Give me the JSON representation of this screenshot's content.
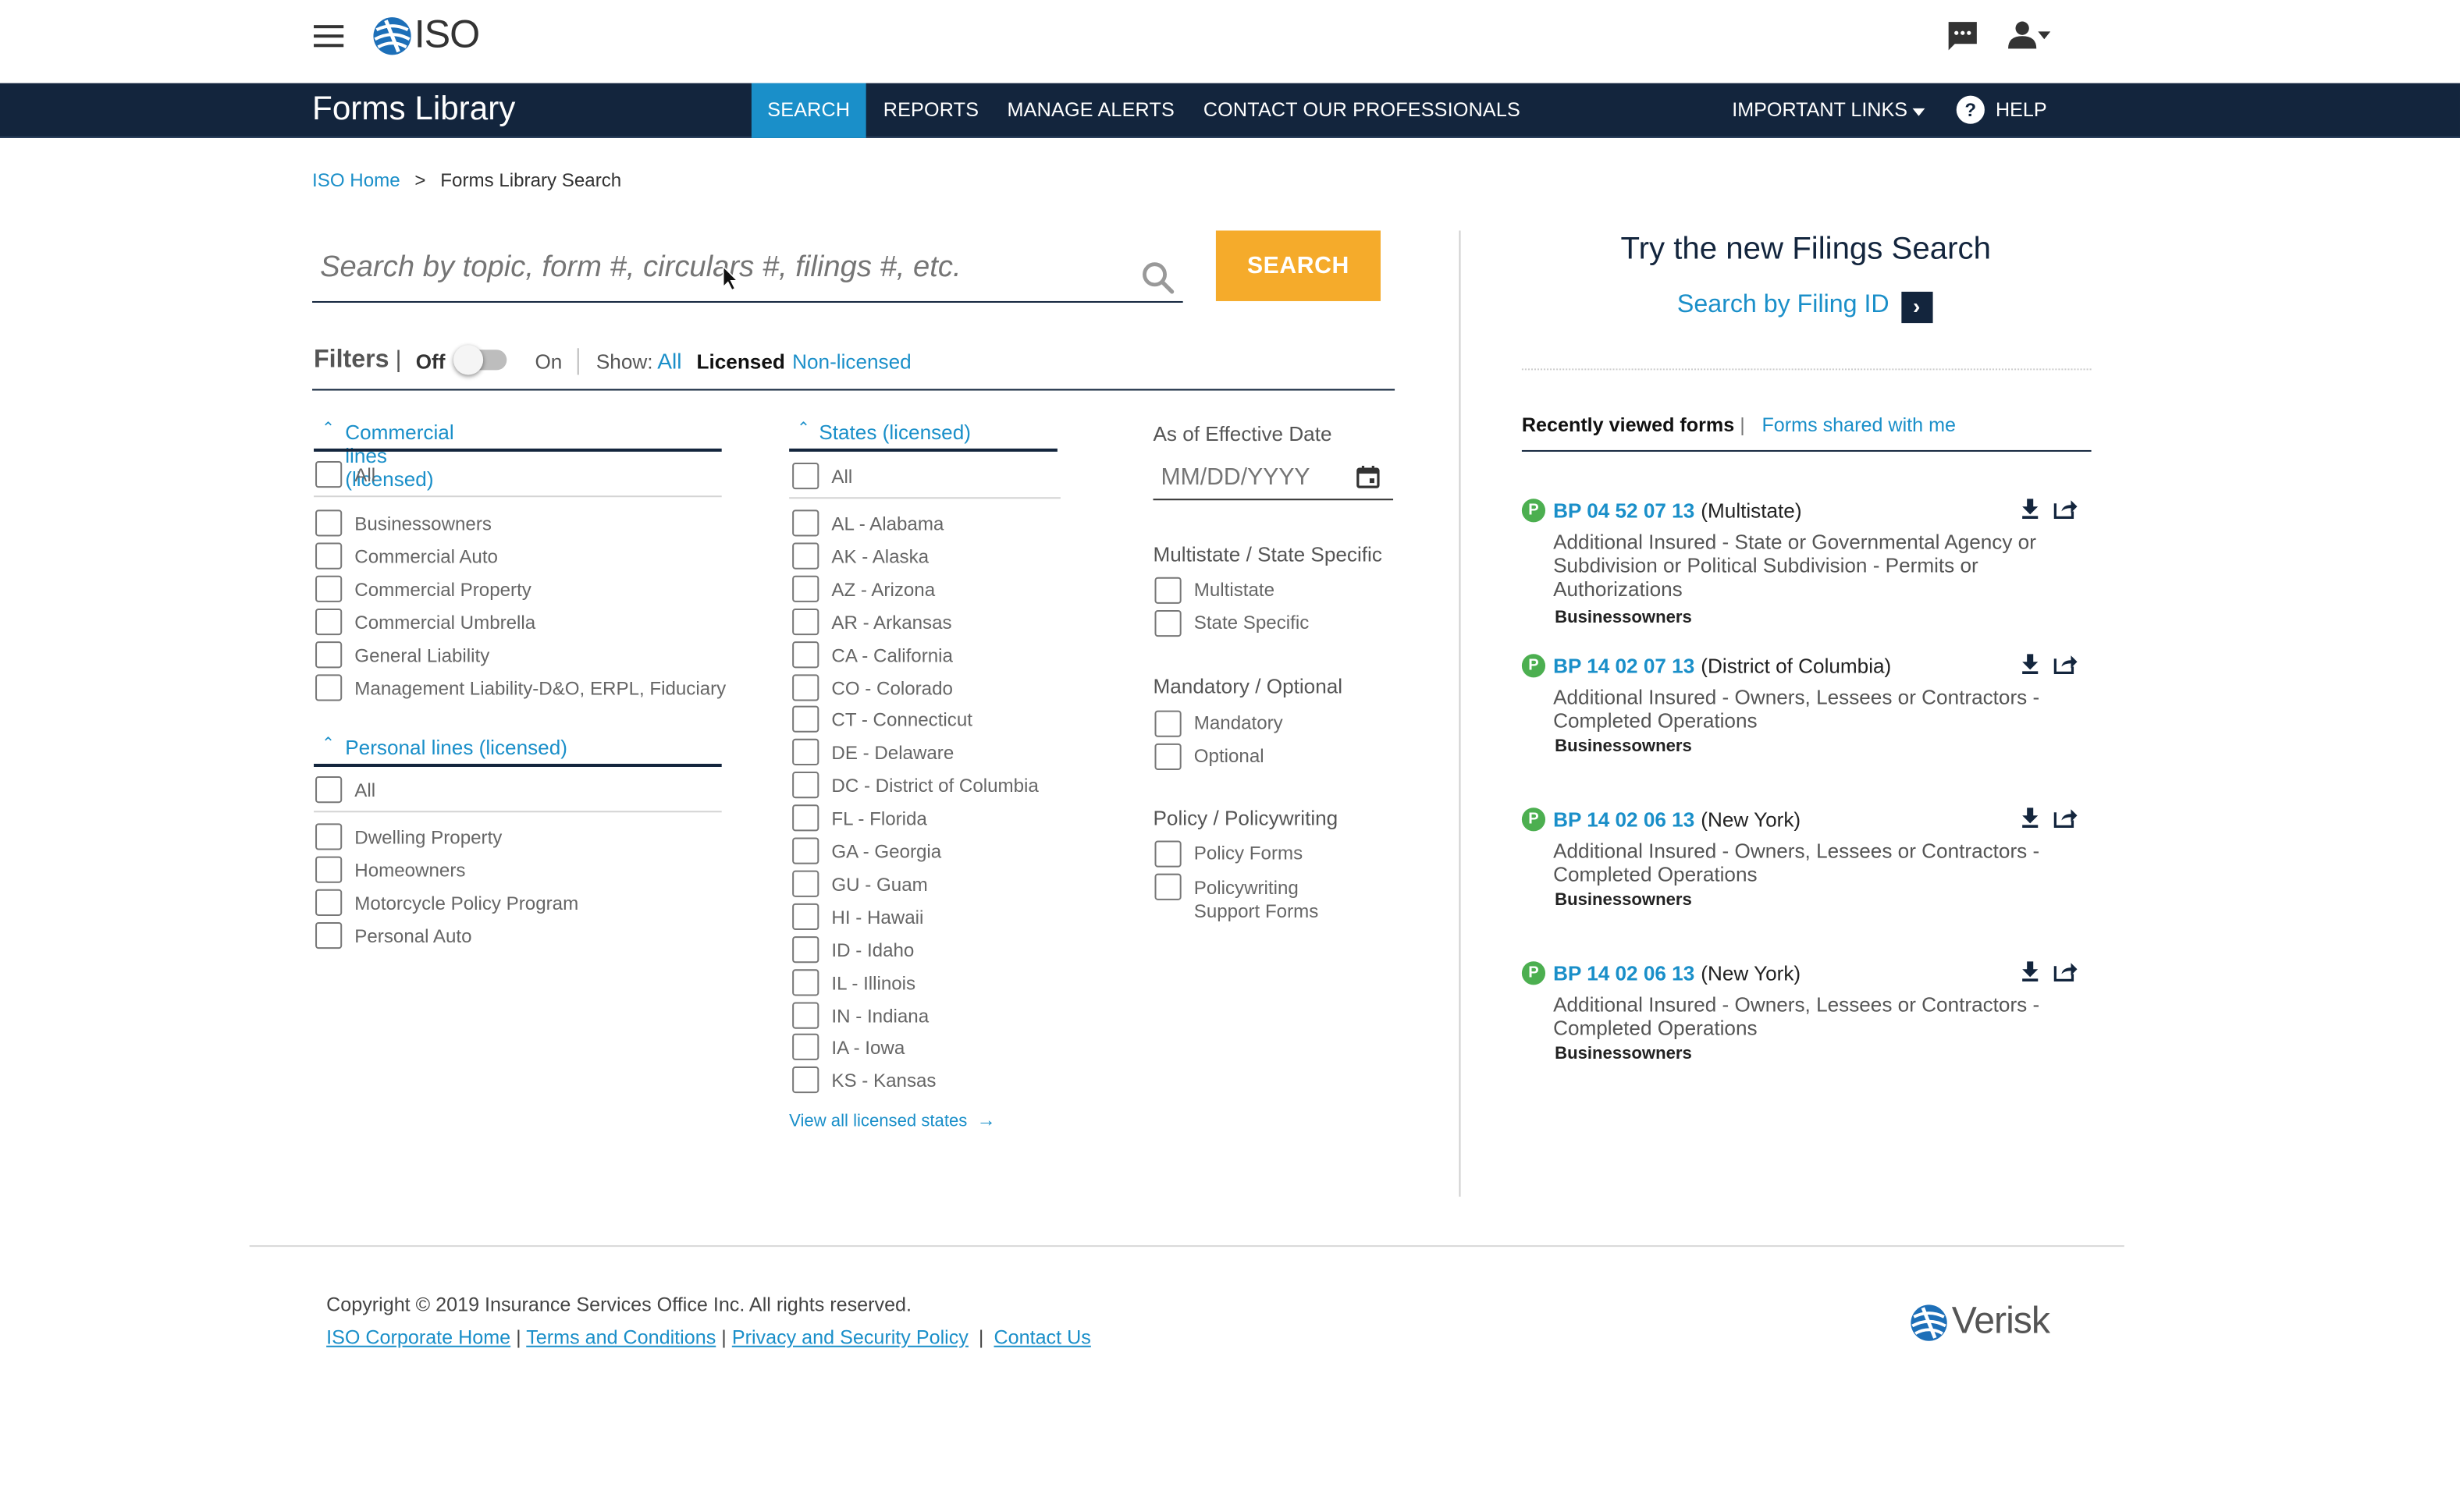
{
  "header": {
    "logo_text": "ISO",
    "icons": {
      "menu": "hamburger-menu-icon",
      "chat": "chat-icon",
      "user": "user-account-icon"
    }
  },
  "nav": {
    "app_title": "Forms Library",
    "items": [
      {
        "label": "SEARCH",
        "active": true
      },
      {
        "label": "REPORTS"
      },
      {
        "label": "MANAGE ALERTS"
      },
      {
        "label": "CONTACT OUR PROFESSIONALS"
      }
    ],
    "important_links": "IMPORTANT LINKS",
    "help": "HELP"
  },
  "breadcrumb": {
    "home": "ISO Home",
    "sep": ">",
    "current": "Forms Library Search"
  },
  "search": {
    "placeholder": "Search by topic, form #, circulars #, filings #, etc.",
    "button": "SEARCH"
  },
  "filters": {
    "title": "Filters",
    "sep": "|",
    "off": "Off",
    "on": "On",
    "show_label": "Show:",
    "show_all": "All",
    "show_licensed": "Licensed",
    "show_nonlicensed": "Non-licensed"
  },
  "commercial": {
    "title": "Commercial lines (licensed)",
    "all": "All",
    "items": [
      "Businessowners",
      "Commercial Auto",
      "Commercial Property",
      "Commercial Umbrella",
      "General Liability",
      "Management Liability-D&O, ERPL, Fiduciary"
    ]
  },
  "personal": {
    "title": "Personal lines (licensed)",
    "all": "All",
    "items": [
      "Dwelling Property",
      "Homeowners",
      "Motorcycle Policy Program",
      "Personal Auto"
    ]
  },
  "states": {
    "title": "States (licensed)",
    "all": "All",
    "items": [
      "AL - Alabama",
      "AK - Alaska",
      "AZ - Arizona",
      "AR - Arkansas",
      "CA - California",
      "CO - Colorado",
      "CT - Connecticut",
      "DE - Delaware",
      "DC -  District of Columbia",
      "FL - Florida",
      "GA - Georgia",
      "GU - Guam",
      "HI - Hawaii",
      "ID - Idaho",
      "IL - Illinois",
      "IN - Indiana",
      "IA - Iowa",
      "KS - Kansas"
    ],
    "view_all": "View all licensed states"
  },
  "effective": {
    "label": "As of Effective Date",
    "placeholder": "MM/DD/YYYY"
  },
  "multistate": {
    "title": "Multistate / State Specific",
    "options": [
      "Multistate",
      "State Specific"
    ]
  },
  "mandatory": {
    "title": "Mandatory / Optional",
    "options": [
      "Mandatory",
      "Optional"
    ]
  },
  "policy": {
    "title": "Policy / Policywriting",
    "opt1": "Policy Forms",
    "opt2a": "Policywriting",
    "opt2b": "Support Forms"
  },
  "filings": {
    "title": "Try the new Filings Search",
    "link": "Search by Filing ID"
  },
  "recent": {
    "tab_active": "Recently viewed forms",
    "sep": "|",
    "tab_other": "Forms shared with me",
    "badge": "P",
    "items": [
      {
        "code": "BP 04 52 07 13",
        "state": "(Multistate)",
        "desc": "Additional Insured - State or Governmental Agency or Subdivision or Political Subdivision - Permits or Authorizations",
        "lob": "Businessowners"
      },
      {
        "code": "BP 14 02 07 13",
        "state": "(District of Columbia)",
        "desc": "Additional Insured - Owners, Lessees or Contractors - Completed Operations",
        "lob": "Businessowners"
      },
      {
        "code": "BP 14 02 06 13",
        "state": "(New York)",
        "desc": "Additional Insured - Owners, Lessees or Contractors - Completed Operations",
        "lob": "Businessowners"
      },
      {
        "code": "BP 14 02 06 13",
        "state": "(New York)",
        "desc": "Additional Insured - Owners, Lessees or Contractors - Completed Operations",
        "lob": "Businessowners"
      }
    ]
  },
  "footer": {
    "copyright": "Copyright © 2019 Insurance Services Office Inc. All rights reserved.",
    "links": [
      "ISO Corporate Home",
      "Terms and Conditions",
      "Privacy and Security Policy",
      "Contact Us"
    ],
    "sep": "|",
    "verisk": "Verisk"
  }
}
